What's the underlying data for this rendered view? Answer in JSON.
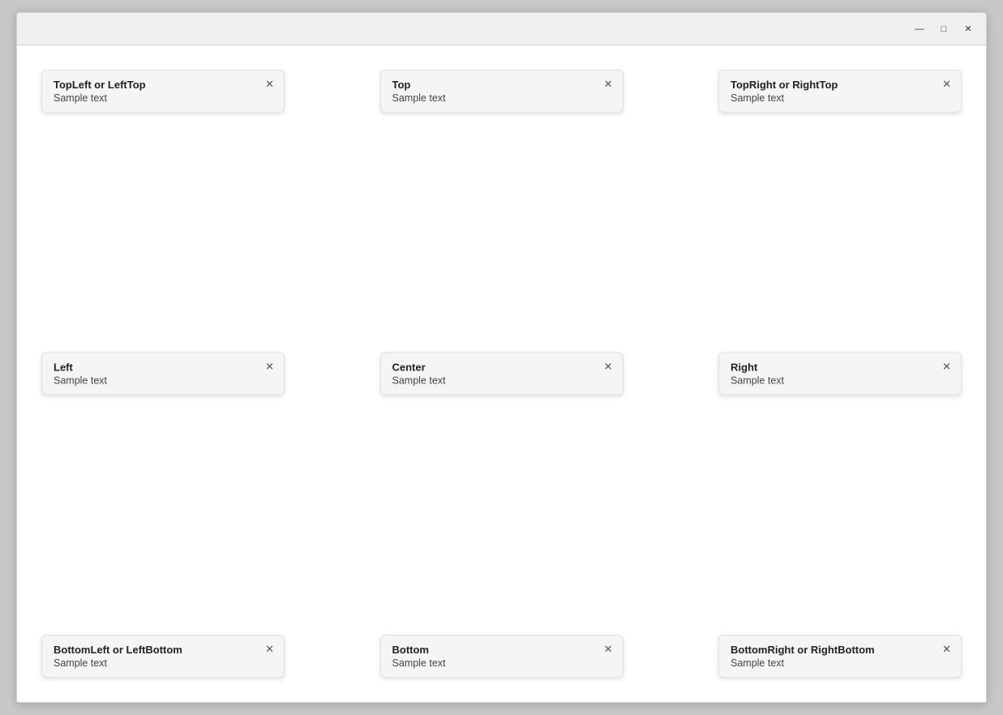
{
  "window": {
    "title": ""
  },
  "titleBar": {
    "minimize": "—",
    "maximize": "□",
    "close": "✕"
  },
  "cards": {
    "topLeft": {
      "title": "TopLeft or LeftTop",
      "text": "Sample text",
      "position": "top-left"
    },
    "top": {
      "title": "Top",
      "text": "Sample text",
      "position": "top"
    },
    "topRight": {
      "title": "TopRight or RightTop",
      "text": "Sample text",
      "position": "top-right"
    },
    "left": {
      "title": "Left",
      "text": "Sample text",
      "position": "left"
    },
    "center": {
      "title": "Center",
      "text": "Sample text",
      "position": "center"
    },
    "right": {
      "title": "Right",
      "text": "Sample text",
      "position": "right"
    },
    "bottomLeft": {
      "title": "BottomLeft or LeftBottom",
      "text": "Sample text",
      "position": "bottom-left"
    },
    "bottom": {
      "title": "Bottom",
      "text": "Sample text",
      "position": "bottom"
    },
    "bottomRight": {
      "title": "BottomRight or RightBottom",
      "text": "Sample text",
      "position": "bottom-right"
    }
  }
}
